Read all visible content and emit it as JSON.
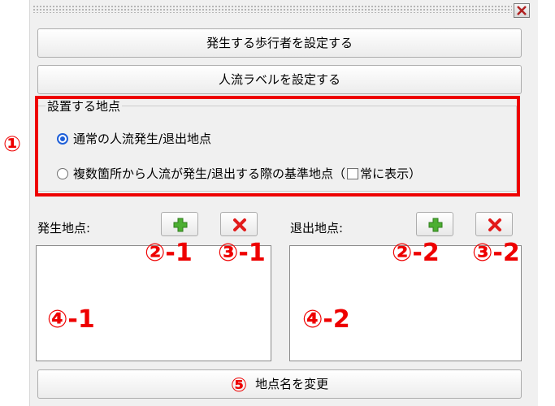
{
  "window": {
    "close_glyph": "×"
  },
  "buttons": {
    "set_walkers": "発生する歩行者を設定する",
    "set_flow_label": "人流ラベルを設定する",
    "rename_point": "地点名を変更"
  },
  "placement": {
    "title": "設置する地点",
    "options": [
      {
        "label": "通常の人流発生/退出地点",
        "selected": true
      },
      {
        "label_before": "複数箇所から人流が発生/退出する際の基準地点（",
        "checkbox_label": "常に表示）",
        "selected": false
      }
    ]
  },
  "origin": {
    "label": "発生地点:"
  },
  "exit": {
    "label": "退出地点:"
  },
  "annotations": {
    "a1": "①",
    "a2_1": "②-1",
    "a3_1": "③-1",
    "a2_2": "②-2",
    "a3_2": "③-2",
    "a4_1": "④-1",
    "a4_2": "④-2",
    "a5": "⑤"
  },
  "colors": {
    "annotation": "#ee0000",
    "add_icon": "#4caf32",
    "remove_icon": "#e21b1b",
    "radio_selected": "#1e5fd8"
  }
}
